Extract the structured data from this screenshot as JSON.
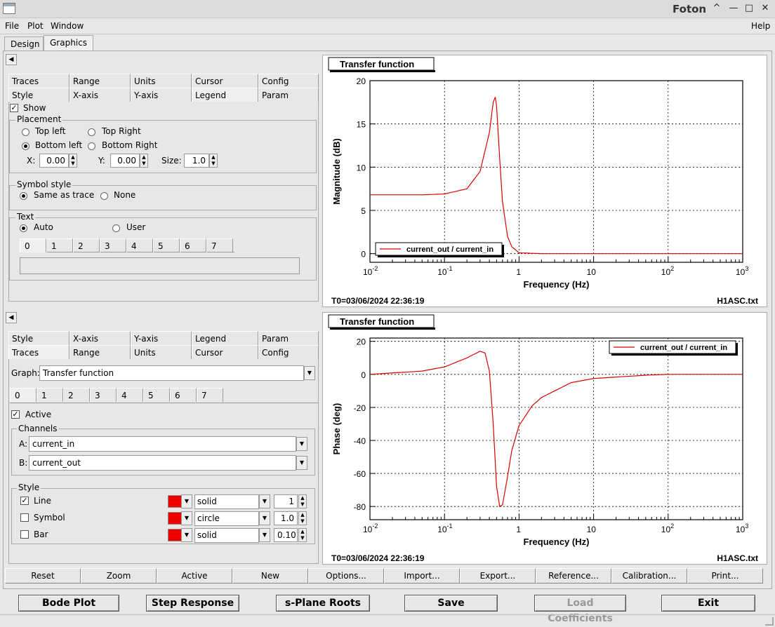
{
  "window": {
    "title": "Foton",
    "controls": [
      "^",
      "—",
      "□",
      "✕"
    ]
  },
  "menu": {
    "file": "File",
    "plot": "Plot",
    "window": "Window",
    "help": "Help"
  },
  "main_tabs": [
    "Design",
    "Graphics"
  ],
  "legend_panel": {
    "tabs_row1": [
      "Traces",
      "Range",
      "Units",
      "Cursor",
      "Config"
    ],
    "tabs_row2": [
      "Style",
      "X-axis",
      "Y-axis",
      "Legend",
      "Param"
    ],
    "show_label": "Show",
    "placement_title": "Placement",
    "top_left": "Top left",
    "top_right": "Top Right",
    "bottom_left": "Bottom left",
    "bottom_right": "Bottom Right",
    "x_label": "X:",
    "x_value": "0.00",
    "y_label": "Y:",
    "y_value": "0.00",
    "size_label": "Size:",
    "size_value": "1.0",
    "symbol_title": "Symbol style",
    "same_as_trace": "Same as trace",
    "none": "None",
    "text_title": "Text",
    "auto": "Auto",
    "user": "User",
    "num_tabs": [
      "0",
      "1",
      "2",
      "3",
      "4",
      "5",
      "6",
      "7"
    ]
  },
  "traces_panel": {
    "tabs_row1": [
      "Style",
      "X-axis",
      "Y-axis",
      "Legend",
      "Param"
    ],
    "tabs_row2": [
      "Traces",
      "Range",
      "Units",
      "Cursor",
      "Config"
    ],
    "graph_label": "Graph:",
    "graph_value": "Transfer function",
    "num_tabs": [
      "0",
      "1",
      "2",
      "3",
      "4",
      "5",
      "6",
      "7"
    ],
    "active_label": "Active",
    "channels_title": "Channels",
    "a_label": "A:",
    "a_value": "current_in",
    "b_label": "B:",
    "b_value": "current_out",
    "style_title": "Style",
    "line_label": "Line",
    "line_style": "solid",
    "line_width": "1",
    "symbol_label": "Symbol",
    "symbol_style": "circle",
    "symbol_size": "1.0",
    "bar_label": "Bar",
    "bar_style": "solid",
    "bar_width": "0.10"
  },
  "plot1": {
    "title": "Transfer function",
    "ylabel": "Magnitude (dB)",
    "xlabel": "Frequency (Hz)",
    "footer_left": "T0=03/06/2024 22:36:19",
    "footer_right": "H1ASC.txt",
    "legend": "current_out / current_in"
  },
  "plot2": {
    "title": "Transfer function",
    "ylabel": "Phase (deg)",
    "xlabel": "Frequency (Hz)",
    "footer_left": "T0=03/06/2024 22:36:19",
    "footer_right": "H1ASC.txt",
    "legend": "current_out / current_in"
  },
  "toolbar": [
    "Reset",
    "Zoom",
    "Active",
    "New",
    "Options...",
    "Import...",
    "Export...",
    "Reference...",
    "Calibration...",
    "Print..."
  ],
  "bottom_buttons": [
    "Bode Plot",
    "Step Response",
    "s-Plane Roots",
    "Save",
    "Load Coefficients",
    "Exit"
  ],
  "colors": {
    "trace": "#dd0000"
  },
  "chart_data": [
    {
      "type": "line",
      "title": "",
      "xlabel": "Frequency (Hz)",
      "ylabel": "Magnitude (dB)",
      "xscale": "log",
      "xlim": [
        0.01,
        1000
      ],
      "ylim": [
        -1,
        20
      ],
      "x_ticks": [
        "10^-2",
        "10^-1",
        "1",
        "10",
        "10^2",
        "10^3"
      ],
      "y_ticks": [
        "0",
        "5",
        "10",
        "15",
        "20"
      ],
      "grid": true,
      "legend_position": "bottom-left",
      "series": [
        {
          "name": "current_out / current_in",
          "x": [
            0.01,
            0.05,
            0.1,
            0.2,
            0.3,
            0.4,
            0.45,
            0.48,
            0.5,
            0.55,
            0.6,
            0.7,
            0.8,
            1,
            2,
            10,
            100,
            1000
          ],
          "y": [
            6.8,
            6.8,
            6.9,
            7.5,
            9.5,
            14,
            17.5,
            18.1,
            17,
            11,
            6,
            2,
            0.8,
            0.1,
            0,
            0,
            0,
            0
          ]
        }
      ]
    },
    {
      "type": "line",
      "title": "",
      "xlabel": "Frequency (Hz)",
      "ylabel": "Phase (deg)",
      "xscale": "log",
      "xlim": [
        0.01,
        1000
      ],
      "ylim": [
        -88,
        22
      ],
      "x_ticks": [
        "10^-2",
        "10^-1",
        "1",
        "10",
        "10^2",
        "10^3"
      ],
      "y_ticks": [
        "-80",
        "-60",
        "-40",
        "-20",
        "0",
        "20"
      ],
      "grid": true,
      "legend_position": "top-right",
      "series": [
        {
          "name": "current_out / current_in",
          "x": [
            0.01,
            0.05,
            0.1,
            0.2,
            0.3,
            0.35,
            0.4,
            0.45,
            0.5,
            0.55,
            0.6,
            0.7,
            0.8,
            1,
            1.5,
            2,
            5,
            10,
            50,
            100,
            1000
          ],
          "y": [
            0,
            2,
            4.5,
            10,
            14,
            13,
            2,
            -30,
            -68,
            -80,
            -79,
            -62,
            -46,
            -31,
            -19,
            -14,
            -5,
            -2.5,
            -0.5,
            0,
            0
          ]
        }
      ]
    }
  ]
}
